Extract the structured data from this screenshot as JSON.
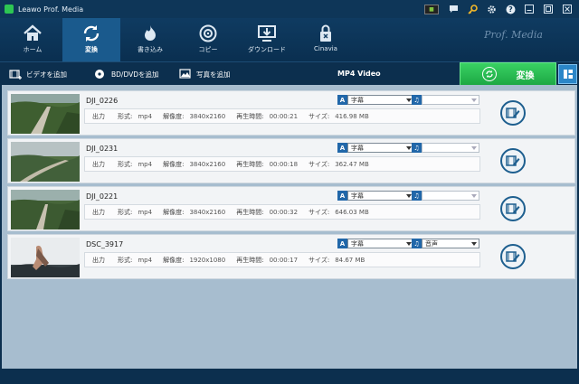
{
  "window": {
    "title": "Leawo Prof. Media"
  },
  "titlebar_icons": [
    "nvidia-icon",
    "chat-icon",
    "key-icon",
    "gear-icon",
    "help-icon",
    "minimize-icon",
    "maximize-icon",
    "close-icon"
  ],
  "nav": {
    "tabs": [
      {
        "label": "ホーム",
        "icon": "home-icon",
        "active": false
      },
      {
        "label": "変換",
        "icon": "convert-icon",
        "active": true
      },
      {
        "label": "書き込み",
        "icon": "burn-icon",
        "active": false
      },
      {
        "label": "コピー",
        "icon": "copy-icon",
        "active": false
      },
      {
        "label": "ダウンロード",
        "icon": "download-icon",
        "active": false
      },
      {
        "label": "Cinavia",
        "icon": "cinavia-icon",
        "active": false
      }
    ],
    "brand": "Prof. Media"
  },
  "toolbar": {
    "add_video": "ビデオを追加",
    "add_disc": "BD/DVDを追加",
    "add_photo": "写真を追加",
    "format": "MP4 Video",
    "convert": "変換"
  },
  "files": [
    {
      "name": "DJI_0226",
      "output_label": "出力",
      "format_label": "形式:",
      "format": "mp4",
      "resolution_label": "解像度:",
      "resolution": "3840x2160",
      "duration_label": "再生時間:",
      "duration": "00:00:21",
      "size_label": "サイズ:",
      "size": "416.98 MB",
      "subtitle": "字幕",
      "audio": ""
    },
    {
      "name": "DJI_0231",
      "output_label": "出力",
      "format_label": "形式:",
      "format": "mp4",
      "resolution_label": "解像度:",
      "resolution": "3840x2160",
      "duration_label": "再生時間:",
      "duration": "00:00:18",
      "size_label": "サイズ:",
      "size": "362.47 MB",
      "subtitle": "字幕",
      "audio": ""
    },
    {
      "name": "DJI_0221",
      "output_label": "出力",
      "format_label": "形式:",
      "format": "mp4",
      "resolution_label": "解像度:",
      "resolution": "3840x2160",
      "duration_label": "再生時間:",
      "duration": "00:00:32",
      "size_label": "サイズ:",
      "size": "646.03 MB",
      "subtitle": "字幕",
      "audio": ""
    },
    {
      "name": "DSC_3917",
      "output_label": "出力",
      "format_label": "形式:",
      "format": "mp4",
      "resolution_label": "解像度:",
      "resolution": "1920x1080",
      "duration_label": "再生時間:",
      "duration": "00:00:17",
      "size_label": "サイズ:",
      "size": "84.67 MB",
      "subtitle": "字幕",
      "audio": "音声"
    }
  ],
  "colors": {
    "accent_green": "#2dc653",
    "nav_bg": "#0f3b61",
    "list_bg": "#a7bdcf"
  }
}
